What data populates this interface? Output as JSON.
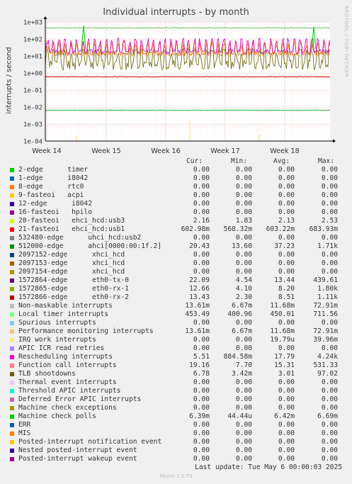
{
  "chart_data": {
    "type": "line",
    "title": "Individual interrupts - by month",
    "ylabel": "interrupts / second",
    "y_scale": "log",
    "ylim": [
      0.0001,
      1000
    ],
    "y_ticks": [
      "1e+03",
      "1e+02",
      "1e+01",
      "1e+00",
      "1e-01",
      "1e-02",
      "1e-03",
      "1e-04"
    ],
    "x_ticks": [
      "Week 14",
      "Week 15",
      "Week 16",
      "Week 17",
      "Week 18"
    ],
    "grid": true,
    "series_approx": [
      {
        "key": "local_timer",
        "level": 450,
        "color": "#66cc66"
      },
      {
        "key": "perf_mon",
        "level": 13.6,
        "color": "#ffb366"
      },
      {
        "key": "tlb",
        "level": 3.0,
        "color": "#666600"
      },
      {
        "key": "resched",
        "level": 17.8,
        "color": "#cc00cc"
      },
      {
        "key": "ehci_usb1",
        "level": 0.6,
        "color": "#cc0000"
      },
      {
        "key": "eth0_tx",
        "level": 13.4,
        "color": "#ff6600"
      },
      {
        "key": "mce_polls",
        "level": 0.0064,
        "color": "#00aa00"
      },
      {
        "key": "irq_work",
        "level": 1.98e-05,
        "color": "#ffe066"
      }
    ]
  },
  "side_label": "RRDTOOL / TOBI OETIKER",
  "legend": {
    "headers": {
      "cur": "Cur:",
      "min": "Min:",
      "avg": "Avg:",
      "max": "Max:"
    },
    "rows": [
      {
        "name": "2-edge      timer",
        "color": "#00cc00",
        "cur": "0.00",
        "min": "0.00",
        "avg": "0.00",
        "max": "0.00"
      },
      {
        "name": "1-edge      i8042",
        "color": "#0066b3",
        "cur": "0.00",
        "min": "0.00",
        "avg": "0.00",
        "max": "0.00"
      },
      {
        "name": "8-edge      rtc0",
        "color": "#ff8000",
        "cur": "0.00",
        "min": "0.00",
        "avg": "0.00",
        "max": "0.00"
      },
      {
        "name": "9-fasteoi   acpi",
        "color": "#ffcc00",
        "cur": "0.00",
        "min": "0.00",
        "avg": "0.00",
        "max": "0.00"
      },
      {
        "name": "12-edge      i8042",
        "color": "#330099",
        "cur": "0.00",
        "min": "0.00",
        "avg": "0.00",
        "max": "0.00"
      },
      {
        "name": "16-fasteoi   hpilo",
        "color": "#990099",
        "cur": "0.00",
        "min": "0.00",
        "avg": "0.00",
        "max": "0.00"
      },
      {
        "name": "20-fasteoi   ehci_hcd:usb3",
        "color": "#ccff00",
        "cur": "2.16",
        "min": "1.83",
        "avg": "2.13",
        "max": "2.53"
      },
      {
        "name": "21-fasteoi   ehci_hcd:usb1",
        "color": "#ff0000",
        "cur": "602.98m",
        "min": "568.32m",
        "avg": "603.22m",
        "max": "683.93m"
      },
      {
        "name": "532480-edge      uhci_hcd:usb2",
        "color": "#808080",
        "cur": "0.00",
        "min": "0.00",
        "avg": "0.00",
        "max": "0.00"
      },
      {
        "name": "512000-edge      ahci[0000:00:1f.2]",
        "color": "#008f00",
        "cur": "20.43",
        "min": "13.60",
        "avg": "37.23",
        "max": "1.71k"
      },
      {
        "name": "2097152-edge      xhci_hcd",
        "color": "#00487d",
        "cur": "0.00",
        "min": "0.00",
        "avg": "0.00",
        "max": "0.00"
      },
      {
        "name": "2097153-edge      xhci_hcd",
        "color": "#b35a00",
        "cur": "0.00",
        "min": "0.00",
        "avg": "0.00",
        "max": "0.00"
      },
      {
        "name": "2097154-edge      xhci_hcd",
        "color": "#b38f00",
        "cur": "0.00",
        "min": "0.00",
        "avg": "0.00",
        "max": "0.00"
      },
      {
        "name": "1572864-edge      eth0-tx-0",
        "color": "#6b006b",
        "cur": "22.09",
        "min": "4.54",
        "avg": "13.44",
        "max": "439.61"
      },
      {
        "name": "1572865-edge      eth0-rx-1",
        "color": "#8fb300",
        "cur": "12.66",
        "min": "4.10",
        "avg": "8.20",
        "max": "1.80k"
      },
      {
        "name": "1572866-edge      eth0-rx-2",
        "color": "#b30000",
        "cur": "13.43",
        "min": "2.30",
        "avg": "8.51",
        "max": "1.11k"
      },
      {
        "name": "Non-maskable interrupts",
        "color": "#bebebe",
        "cur": "13.61m",
        "min": "6.67m",
        "avg": "11.68m",
        "max": "72.91m"
      },
      {
        "name": "Local timer interrupts",
        "color": "#80ff80",
        "cur": "453.49",
        "min": "400.96",
        "avg": "450.01",
        "max": "711.56"
      },
      {
        "name": "Spurious interrupts",
        "color": "#80c9ff",
        "cur": "0.00",
        "min": "0.00",
        "avg": "0.00",
        "max": "0.00"
      },
      {
        "name": "Performance monitoring interrupts",
        "color": "#ffc080",
        "cur": "13.61m",
        "min": "6.67m",
        "avg": "11.68m",
        "max": "72.91m"
      },
      {
        "name": "IRQ work interrupts",
        "color": "#ffe680",
        "cur": "0.00",
        "min": "0.00",
        "avg": "19.79u",
        "max": "39.96m"
      },
      {
        "name": "APIC ICR read retries",
        "color": "#aa80ff",
        "cur": "0.00",
        "min": "0.00",
        "avg": "0.00",
        "max": "0.00"
      },
      {
        "name": "Rescheduling interrupts",
        "color": "#ee00cc",
        "cur": "5.51",
        "min": "884.58m",
        "avg": "17.79",
        "max": "4.24k"
      },
      {
        "name": "Function call interrupts",
        "color": "#ff8080",
        "cur": "19.16",
        "min": "7.70",
        "avg": "15.31",
        "max": "531.33"
      },
      {
        "name": "TLB shootdowns",
        "color": "#666600",
        "cur": "6.78",
        "min": "3.42m",
        "avg": "3.01",
        "max": "97.02"
      },
      {
        "name": "Thermal event interrupts",
        "color": "#ffbfff",
        "cur": "0.00",
        "min": "0.00",
        "avg": "0.00",
        "max": "0.00"
      },
      {
        "name": "Threshold APIC interrupts",
        "color": "#00ffcc",
        "cur": "0.00",
        "min": "0.00",
        "avg": "0.00",
        "max": "0.00"
      },
      {
        "name": "Deferred Error APIC interrupts",
        "color": "#cc6699",
        "cur": "0.00",
        "min": "0.00",
        "avg": "0.00",
        "max": "0.00"
      },
      {
        "name": "Machine check exceptions",
        "color": "#999900",
        "cur": "0.00",
        "min": "0.00",
        "avg": "0.00",
        "max": "0.00"
      },
      {
        "name": "Machine check polls",
        "color": "#00cc00",
        "cur": "6.39m",
        "min": "44.44u",
        "avg": "6.42m",
        "max": "6.69m"
      },
      {
        "name": "ERR",
        "color": "#0066b3",
        "cur": "0.00",
        "min": "0.00",
        "avg": "0.00",
        "max": "0.00"
      },
      {
        "name": "MIS",
        "color": "#ff8000",
        "cur": "0.00",
        "min": "0.00",
        "avg": "0.00",
        "max": "0.00"
      },
      {
        "name": "Posted-interrupt notification event",
        "color": "#ffcc00",
        "cur": "0.00",
        "min": "0.00",
        "avg": "0.00",
        "max": "0.00"
      },
      {
        "name": "Nested posted-interrupt event",
        "color": "#330099",
        "cur": "0.00",
        "min": "0.00",
        "avg": "0.00",
        "max": "0.00"
      },
      {
        "name": "Posted-interrupt wakeup event",
        "color": "#990099",
        "cur": "0.00",
        "min": "0.00",
        "avg": "0.00",
        "max": "0.00"
      }
    ]
  },
  "footer": {
    "last_update": "Last update: Tue May  6 00:00:03 2025",
    "munin": "Munin 2.0.73"
  }
}
